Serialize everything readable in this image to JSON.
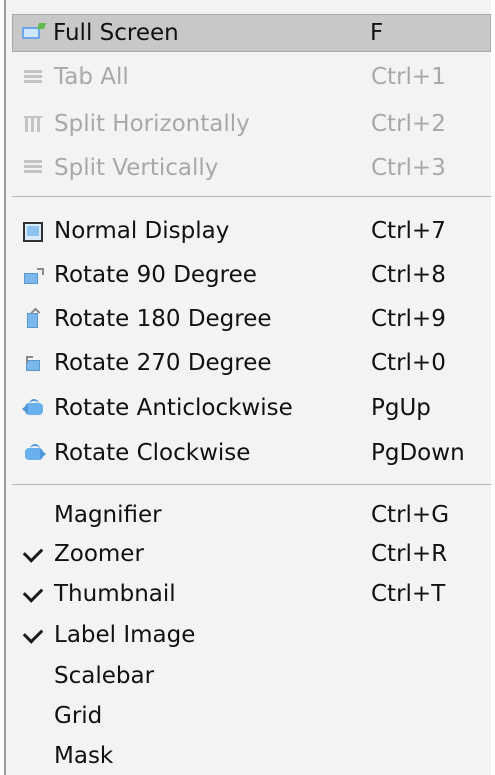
{
  "menu": {
    "items": [
      {
        "label": "Full Screen",
        "shortcut": "F",
        "icon": "full-screen-icon",
        "state": "selected"
      },
      {
        "label": "Tab All",
        "shortcut": "Ctrl+1",
        "icon": "tab-all-icon",
        "state": "disabled"
      },
      {
        "label": "Split Horizontally",
        "shortcut": "Ctrl+2",
        "icon": "split-horizontal-icon",
        "state": "disabled"
      },
      {
        "label": "Split Vertically",
        "shortcut": "Ctrl+3",
        "icon": "split-vertical-icon",
        "state": "disabled"
      },
      {
        "label": "Normal Display",
        "shortcut": "Ctrl+7",
        "icon": "normal-display-icon",
        "state": "normal"
      },
      {
        "label": "Rotate 90 Degree",
        "shortcut": "Ctrl+8",
        "icon": "rotate-90-icon",
        "state": "normal"
      },
      {
        "label": "Rotate 180 Degree",
        "shortcut": "Ctrl+9",
        "icon": "rotate-180-icon",
        "state": "normal"
      },
      {
        "label": "Rotate 270 Degree",
        "shortcut": "Ctrl+0",
        "icon": "rotate-270-icon",
        "state": "normal"
      },
      {
        "label": "Rotate Anticlockwise",
        "shortcut": "PgUp",
        "icon": "rotate-anticlockwise-icon",
        "state": "normal"
      },
      {
        "label": "Rotate Clockwise",
        "shortcut": "PgDown",
        "icon": "rotate-clockwise-icon",
        "state": "normal"
      },
      {
        "label": "Magnifier",
        "shortcut": "Ctrl+G",
        "icon": "",
        "state": "normal",
        "checked": false
      },
      {
        "label": "Zoomer",
        "shortcut": "Ctrl+R",
        "icon": "checkmark-icon",
        "state": "normal",
        "checked": true
      },
      {
        "label": "Thumbnail",
        "shortcut": "Ctrl+T",
        "icon": "checkmark-icon",
        "state": "normal",
        "checked": true
      },
      {
        "label": "Label Image",
        "shortcut": "",
        "icon": "checkmark-icon",
        "state": "normal",
        "checked": true
      },
      {
        "label": "Scalebar",
        "shortcut": "",
        "icon": "",
        "state": "normal",
        "checked": false
      },
      {
        "label": "Grid",
        "shortcut": "",
        "icon": "",
        "state": "normal",
        "checked": false
      },
      {
        "label": "Mask",
        "shortcut": "",
        "icon": "",
        "state": "normal",
        "checked": false
      }
    ]
  },
  "colors": {
    "selected_background": "#c8c8c8",
    "disabled_text": "#a8a8a8",
    "menu_background": "#f3f3f3",
    "separator": "#b6b6b6"
  }
}
